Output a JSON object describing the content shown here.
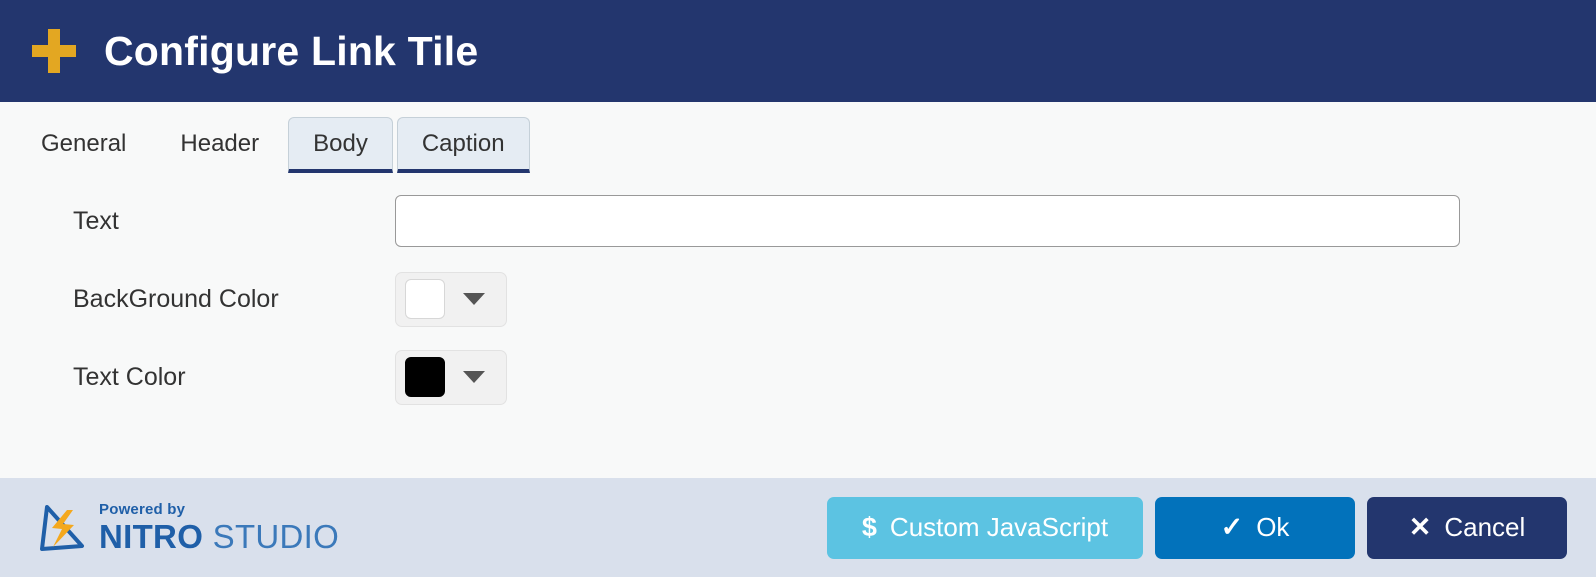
{
  "window": {
    "title": "Configure Link Tile",
    "title_icon": "plus-icon",
    "header_bg": "#23366e",
    "accent_gold": "#e3a722"
  },
  "tabs": [
    {
      "label": "General",
      "active": false
    },
    {
      "label": "Header",
      "active": false
    },
    {
      "label": "Body",
      "active": false
    },
    {
      "label": "Caption",
      "active": true
    }
  ],
  "form": {
    "text": {
      "label": "Text",
      "value": "",
      "placeholder": ""
    },
    "background_color": {
      "label": "BackGround Color",
      "value": "#ffffff",
      "caret_icon": "chevron-down-icon"
    },
    "text_color": {
      "label": "Text Color",
      "value": "#000000",
      "caret_icon": "chevron-down-icon"
    }
  },
  "footer": {
    "logo": {
      "powered_by": "Powered by",
      "brand_bold": "NITRO",
      "brand_light": " STUDIO",
      "mark_icon": "nitro-lightning-triangle-icon"
    },
    "buttons": [
      {
        "label": "Custom JavaScript",
        "icon": "dollar-icon",
        "icon_glyph": "$",
        "color": "#5cc3e2"
      },
      {
        "label": "Ok",
        "icon": "check-icon",
        "icon_glyph": "✓",
        "color": "#0272bb"
      },
      {
        "label": "Cancel",
        "icon": "close-icon",
        "icon_glyph": "✕",
        "color": "#23366e"
      }
    ]
  }
}
